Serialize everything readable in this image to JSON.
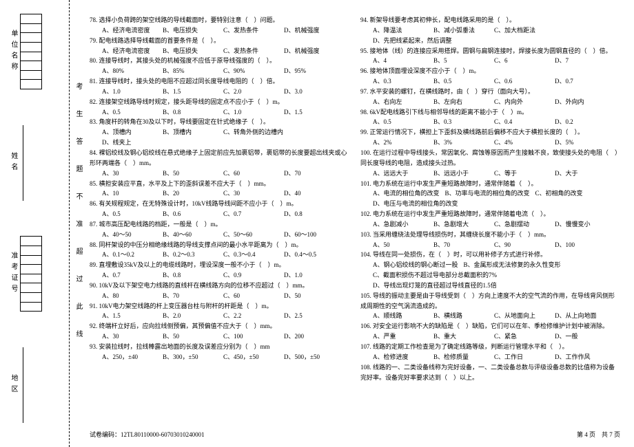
{
  "sidebar": {
    "unit": "单位名称",
    "name": "姓名",
    "ticket": "准考证号",
    "region": "地区"
  },
  "warnline": "考生答题不准超过此线",
  "footer": {
    "code_label": "试卷编码：",
    "code": "12TL80110000-60703010240001",
    "page_label_1": "第",
    "page_num": "4",
    "page_label_2": "页　共",
    "page_total": "7",
    "page_label_3": "页"
  },
  "col1": [
    {
      "n": "78",
      "stem": "选择小负荷跨的架空线路的导线截面时，要特别注意（　）问题。",
      "opts": [
        "A、经济电流密度",
        "B、电压损失",
        "C、发热条件",
        "D、机械强度"
      ]
    },
    {
      "n": "79",
      "stem": "配电线路选择导线截面的首要条件是（　）。",
      "opts": [
        "A、经济电流密度",
        "B、电压损失",
        "C、发热条件",
        "D、机械强度"
      ]
    },
    {
      "n": "80",
      "stem": "连接导线时，其接头处的机械强度不应低于原导线强度的（　）。",
      "opts": [
        "A、80%",
        "B、85%",
        "C、90%",
        "D、95%"
      ]
    },
    {
      "n": "81",
      "stem": "连接导线时，接头处的电阻不应超过同长度导线电阻的（　）倍。",
      "opts": [
        "A、1.0",
        "B、1.5",
        "C、2.0",
        "D、3.0"
      ]
    },
    {
      "n": "82",
      "stem": "连接架空线路导线时规定，接头距导线的固定点不应小于（　）m。",
      "opts": [
        "A、0.5",
        "B、0.8",
        "C、1.0",
        "D、1.5"
      ]
    },
    {
      "n": "83",
      "stem": "角度杆的转角在30及以下时，导线要固定在针式绝缘子（　）。",
      "opts": [
        "A、顶槽内",
        "B、顶槽内",
        "C、转角外侧的边槽内",
        "D、线夹上"
      ]
    },
    {
      "n": "84",
      "stem": "裸铝绞线及钢心铝绞线在悬式绝缘子上固定前应先加裹铝带，裹铝带的长度要超出线夹或心形环两端各（　）mm。",
      "opts": [
        "A、30",
        "B、50",
        "C、60",
        "D、70"
      ]
    },
    {
      "n": "85",
      "stem": "横担安装应平直，水平及上下的歪斜误差不应大于（　）mm。",
      "opts": [
        "A、10",
        "B、20",
        "C、30",
        "D、40"
      ]
    },
    {
      "n": "86",
      "stem": "有关规程规定，在无特殊设计时，10kV线路导线间距不应小于（　）m。",
      "opts": [
        "A、0.5",
        "B、0.6",
        "C、0.7",
        "D、0.8"
      ]
    },
    {
      "n": "87",
      "stem": "城市高压配电线路的档距，一般是（　）m。",
      "opts": [
        "A、40～50",
        "B、40～60",
        "C、50～60",
        "D、60～100"
      ]
    },
    {
      "n": "88",
      "stem": "同杆架设的中压分相绝缘线路的导线支撑点间的最小水平距离为（　）m。",
      "opts": [
        "A、0.1～0.2",
        "B、0.2～0.3",
        "C、0.3～0.4",
        "D、0.4～0.5"
      ]
    },
    {
      "n": "89",
      "stem": "直埋敷设35kV及以上的电缆线路时，埋设深度一般不小于（　）m。",
      "opts": [
        "A、0.7",
        "B、0.8",
        "C、0.9",
        "D、1.0"
      ]
    },
    {
      "n": "90",
      "stem": "10kV及以下架空电力线路的直线杆在横线路方向的位移不应超过（　）mm。",
      "opts": [
        "A、80",
        "B、70",
        "C、60",
        "D、50"
      ]
    },
    {
      "n": "91",
      "stem": "10kV电力架空线路的杆上变压器台柱与附杆的杆距是（　）m。",
      "opts": [
        "A、1.5",
        "B、2.0",
        "C、2.2",
        "D、2.5"
      ]
    },
    {
      "n": "92",
      "stem": "终端杆立好后，应向拉线侧预偏，其预偏值不应大于（　）mm。",
      "opts": [
        "A、30",
        "B、50",
        "C、100",
        "D、200"
      ]
    },
    {
      "n": "93",
      "stem": "安装拉线时，拉线棒露出地面的长度及误差应分别为（　）mm",
      "opts": [
        "A、250，±40",
        "B、300，±50",
        "C、450，±50",
        "D、500，±50"
      ]
    }
  ],
  "col2": [
    {
      "n": "94",
      "stem": "新架导线要考虑其初伸长，配电线路采用的是（　）。",
      "opts": [
        "A、降温法",
        "B、减小弧垂法",
        "C、加大档距法",
        "D、先把线紧起来，然后调整"
      ]
    },
    {
      "n": "95",
      "stem": "接地体（线）的连接应采用搭焊。圆钢与扁钢连接时，焊接长度为圆钢直径的（　）倍。",
      "opts": [
        "A、4",
        "B、5",
        "C、6",
        "D、7"
      ]
    },
    {
      "n": "96",
      "stem": "接地体顶面埋设深度不应小于（　）m。",
      "opts": [
        "A、0.3",
        "B、0.5",
        "C、0.6",
        "D、0.7"
      ]
    },
    {
      "n": "97",
      "stem": "水平安装的螺钉，在横线路时，由（　）穿行（面向大号）。",
      "opts": [
        "A、右向左",
        "B、左向右",
        "C、内向外",
        "D、外向内"
      ]
    },
    {
      "n": "98",
      "stem": "6kV配电线路引下线与相邻导线的距离不能小于（　）m。",
      "opts": [
        "A、0.5",
        "B、0.3",
        "C、0.4",
        "D、0.2"
      ]
    },
    {
      "n": "99",
      "stem": "正常运行情况下，横担上下歪斜及横线路前后偏移不应大于横担长度的（　）。",
      "opts": [
        "A、2%",
        "B、3%",
        "C、4%",
        "D、5%"
      ]
    },
    {
      "n": "100",
      "stem": "在运行过程中导线接头，常因氧化、腐蚀等原因而产生接触不良，致使接头处的电阻（　）同长度导线的电阻，造成接头过热。",
      "opts": [
        "A、远远大于",
        "B、远远小于",
        "C、等于",
        "D、大于"
      ]
    },
    {
      "n": "101",
      "stem": "电力系统在运行中发生严重短路故障时，通常伴随着（　）。",
      "opts": [
        "A、电流的相位角的改变",
        "B、功率与电流的相位角的改变",
        "C、初相角的改变",
        "D、电压与电流的相位角的改变"
      ]
    },
    {
      "n": "102",
      "stem": "电力系统在运行中发生严重短路故障时，通常伴随着电流（　）。",
      "opts": [
        "A、急剧减小",
        "B、急剧增大",
        "C、急剧摆动",
        "D、慢慢变小"
      ]
    },
    {
      "n": "103",
      "stem": "当采用缠绕法处理导线损伤时，其缠绕长度不能小于（　）mm。",
      "opts": [
        "A、50",
        "B、70",
        "C、90",
        "D、100"
      ]
    },
    {
      "n": "104",
      "stem": "导线在同一处损伤，在（　）时，可以用补修子方式进行补修。",
      "opts": [
        "A、钢心铝绞线的钢心断过一股",
        "B、金属形成无法修复的永久性变形",
        "C、截面积损伤不超过导电部分总截面积的7%",
        "D、导线出现灯笼的直径超过导线直径的1.5倍"
      ]
    },
    {
      "n": "105",
      "stem": "导线的振动主要是由于导线受到（　）方向上速度不大的空气流的作用，在导线背风侧形成周期性的空气涡流造成的。",
      "opts": [
        "A、顺线路",
        "B、横线路",
        "C、从地面向上",
        "D、从上向地面"
      ]
    },
    {
      "n": "106",
      "stem": "对安全运行影响不大的缺陷是（　）缺陷，它们可以在年、季检修维护计划中被消除。",
      "opts": [
        "A、严重",
        "B、重大",
        "C、紧急",
        "D、一般"
      ]
    },
    {
      "n": "107",
      "stem": "线路的定期工作检查是为了确定线路等级，判断运行管理水平和（　）。",
      "opts": [
        "A、检修进度",
        "B、检修质量",
        "C、工作日",
        "D、工作作风"
      ]
    },
    {
      "n": "108",
      "stem": "线路的一、二类设备线称为完好设备，一、二类设备总数与评级设备总数的比值称为设备完好率。设备完好率要求达到（　）以上。",
      "opts": []
    }
  ]
}
